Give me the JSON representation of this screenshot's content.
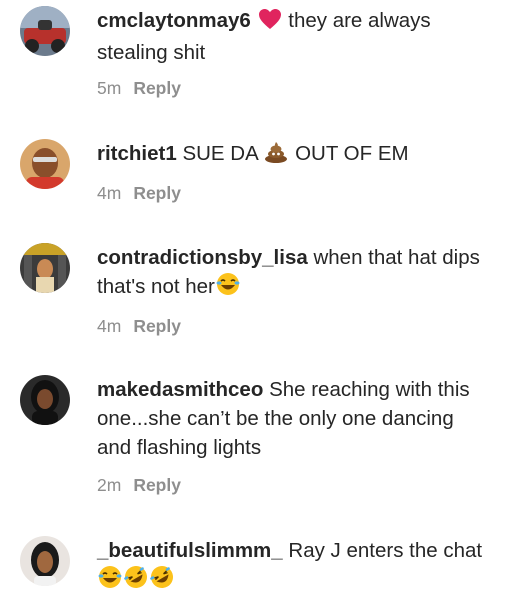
{
  "comments": [
    {
      "username": "cmclaytonmay6",
      "emoji_before": "heart-emoji",
      "text": "they are always stealing shit",
      "time": "5m",
      "reply_label": "Reply"
    },
    {
      "username": "ritchiet1",
      "text_before": "SUE DA",
      "emoji_mid": "poop-emoji",
      "text": "OUT OF EM",
      "time": "4m",
      "reply_label": "Reply"
    },
    {
      "username": "contradictionsby_lisa",
      "text": "when that hat dips that's not her",
      "emoji_after": [
        "laughing-tears-emoji"
      ],
      "time": "4m",
      "reply_label": "Reply"
    },
    {
      "username": "makedasmithceo",
      "text": "She reaching with this one...she can’t be the only one dancing and flashing lights",
      "time": "2m",
      "reply_label": "Reply"
    },
    {
      "username": "_beautifulslimmm_",
      "text": "Ray J enters the chat",
      "emoji_after": [
        "laughing-tears-emoji",
        "rofl-emoji",
        "rofl-emoji"
      ]
    }
  ]
}
